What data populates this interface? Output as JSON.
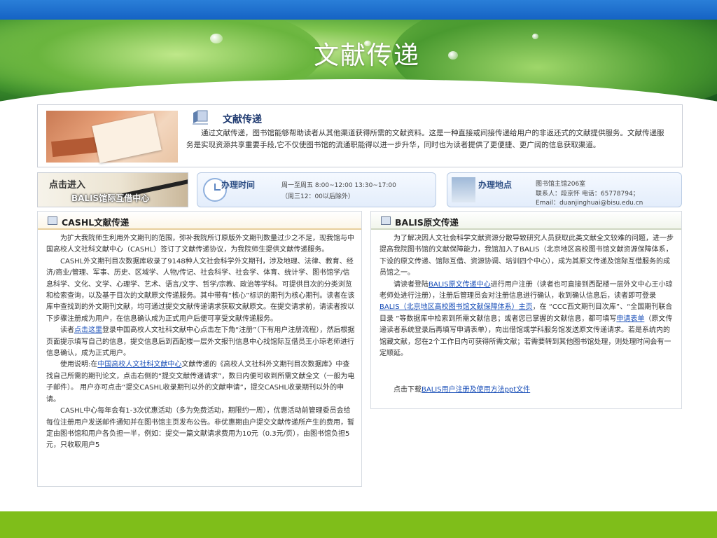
{
  "banner": {
    "title": "文献传递"
  },
  "intro": {
    "heading": "文献传递",
    "text": "通过文献传递，图书馆能够帮助读者从其他渠道获得所需的文献资料。这是一种直接或间接传递给用户的非返还式的文献提供服务。文献传递服务是实现资源共享重要手段,它不仅使图书馆的流通职能得以进一步升华，同时也为读者提供了更便捷、更广阔的信息获取渠道。"
  },
  "enter_banner": {
    "line1": "点击进入",
    "line2": "BALIS馆际互借中心"
  },
  "hours": {
    "label": "办理时间",
    "line1": "周一至周五  8:00~12:00  13:30~17:00",
    "line2": "（周三12：00以后除外）"
  },
  "location": {
    "label": "办理地点",
    "line1": "图书馆主馆206室",
    "line2": "联系人：段京怀    电话：65778794；",
    "line3": "Email：duanjinghuai@bisu.edu.cn"
  },
  "cashl": {
    "title": "CASHL文献传递",
    "p1": "为扩大我院师生利用外文期刊的范围，弥补我院所订原版外文期刊数量过少之不足，现我馆与中国高校人文社科文献中心（CASHL）签订了文献传递协议，为我院师生提供文献传递服务。",
    "p2": "CASHL外文期刊目次数据库收录了9148种人文社会科学外文期刊，涉及地理、法律、教育、经济/商业/管理、军事、历史、区域学、人物/传记、社会科学、社会学、体育、统计学、图书馆学/信息科学、文化、文学、心理学、艺术、语言/文字、哲学/宗教、政治等学科。可提供目次的分类浏览和检索查询，以及基于目次的文献原文传递服务。其中带有“核心”标识的期刊为核心期刊。读者在该库中查找到的外文期刊文献，均可通过提交文献传递请求获取文献原文。在提交请求前，请读者按以下步骤注册成为用户，在信息确认成为正式用户后便可享受文献传递服务。",
    "p3_pre": "读者",
    "p3_link": "点击这里",
    "p3_post": "登录中国高校人文社科文献中心点击左下角“注册”（下有用户注册流程），然后根据页面提示填写自己的信息，提交信息后到西配楼一层外文报刊信息中心找馆际互借员王小琼老师进行信息确认，成为正式用户。",
    "p4_pre": "使用说明:在",
    "p4_link": "中国高校人文社科文献中心",
    "p4_post": "文献传递的《高校人文社科外文期刊目次数据库》中查找自己所需的期刊论文，点击右侧的“提交文献传递请求”，数日内便可收到所需文献全文（一般为电子邮件）。  用户亦可点击“提交CASHL收录期刊以外的文献申请”，提交CASHL收录期刊以外的申请。",
    "p5": "CASHL中心每年会有1-3次优惠活动（多为免费活动，期限约一周），优惠活动前管理委员会给每位注册用户发送邮件通知并在图书馆主页发布公告。非优惠期由户提交文献传递所产生的费用，暂定由图书馆和用户各负担一半，例如：提交一篇文献请求费用为10元（0.3元/页），由图书馆负担5元，只收取用户5"
  },
  "balis": {
    "title": "BALIS原文传递",
    "p1": "为了解决因人文社会科学文献资源分散导致研究人员获取此类文献全文较难的问题，进一步提高我院图书馆的文献保障能力，我馆加入了BALIS（北京地区高校图书馆文献资源保障体系，下设的原文传递、馆际互借、资源协调、培训四个中心），成为其原文传递及馆际互借服务的成员馆之一。",
    "p2_pre": "请读者登陆",
    "p2_link1": "BALIS原文传递中心",
    "p2_mid1": "进行用户注册（读者也可直接到西配楼一层外文中心王小琼老师处进行注册），注册后管理员会对注册信息进行确认，收到确认信息后，读者即可登录",
    "p2_link2": "BALIS（北京地区高校图书馆文献保障体系）主页",
    "p2_mid2": "，在 “CCC西文期刊目次库”、“全国期刊联合目录 ”等数据库中检索到所需文献信息；或者您已掌握的文献信息，都可填写",
    "p2_link3": "申请表单",
    "p2_post": "（原文传递读者系统登录后再填写申请表单），向出借馆或学科服务馆发送原文传递请求。若是系统内的馆藏文献，您在2个工作日内可获得所需文献；若需要转到其他图书馆处理，则处理时间会有一定顺延。",
    "dl_pre": "点击下载",
    "dl_link": "BALIS用户注册及使用方法ppt文件"
  }
}
